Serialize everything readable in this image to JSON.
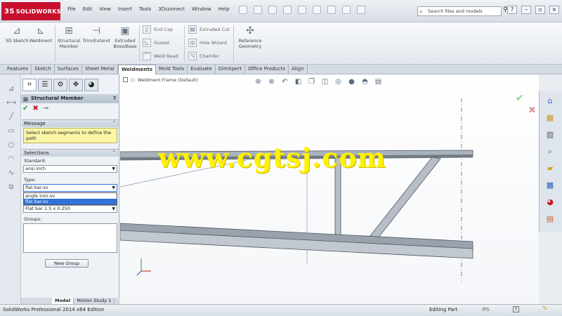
{
  "app": {
    "logo_prefix": "3S",
    "logo_text": "SOLIDWORKS"
  },
  "menu": [
    "File",
    "Edit",
    "View",
    "Insert",
    "Tools",
    "3Dconnect",
    "Window",
    "Help"
  ],
  "search": {
    "placeholder": "Search files and models"
  },
  "commands": {
    "big": [
      {
        "label": "3D Sketch",
        "icon": "sketch-3d-icon"
      },
      {
        "label": "Weldment",
        "icon": "weldment-icon"
      },
      {
        "label": "Structural Member",
        "icon": "structural-member-icon"
      },
      {
        "label": "Trim/Extend",
        "icon": "trim-extend-icon"
      },
      {
        "label": "Extruded Boss/Base",
        "icon": "extruded-boss-icon"
      }
    ],
    "small": [
      {
        "label": "End Cap",
        "icon": "end-cap-icon"
      },
      {
        "label": "Gusset",
        "icon": "gusset-icon"
      },
      {
        "label": "Weld Bead",
        "icon": "weld-bead-icon"
      },
      {
        "label": "Extruded Cut",
        "icon": "extruded-cut-icon"
      },
      {
        "label": "Hole Wizard",
        "icon": "hole-wizard-icon"
      },
      {
        "label": "Chamfer",
        "icon": "chamfer-icon"
      }
    ],
    "reference_geometry": "Reference Geometry"
  },
  "tabs": [
    "Features",
    "Sketch",
    "Surfaces",
    "Sheet Metal",
    "Weldments",
    "Mold Tools",
    "Evaluate",
    "DimXpert",
    "Office Products",
    "Align"
  ],
  "active_tab": "Weldments",
  "property_manager": {
    "title": "Structural Member",
    "help": "?",
    "message_header": "Message",
    "message": "Select sketch segments to define the path",
    "selections_header": "Selections",
    "standard_label": "Standard:",
    "standard_value": "ansi inch",
    "type_label": "Type:",
    "type_value": "flat bar-sv",
    "type_options": [
      "angle iron-sv",
      "flat bar-sv"
    ],
    "size_value": "Flat bar 1.5 x 0.250",
    "groups_label": "Groups:",
    "new_group": "New Group"
  },
  "bottom_tabs": [
    "Model",
    "Motion Study 1"
  ],
  "viewport": {
    "breadcrumb": "Weldment Frame (Default)",
    "watermark": "www.cgtsj.com"
  },
  "status": {
    "left": "SolidWorks Professional 2014 x64 Edition",
    "mode": "Editing Part",
    "units": "IPS",
    "help": "?"
  },
  "colors": {
    "logo_bg": "#c8102e",
    "ok": "#1e9c2a",
    "cancel": "#c81d1d",
    "message_bg": "#fbf6a6",
    "selection": "#3173d8",
    "watermark": "#fff200"
  }
}
